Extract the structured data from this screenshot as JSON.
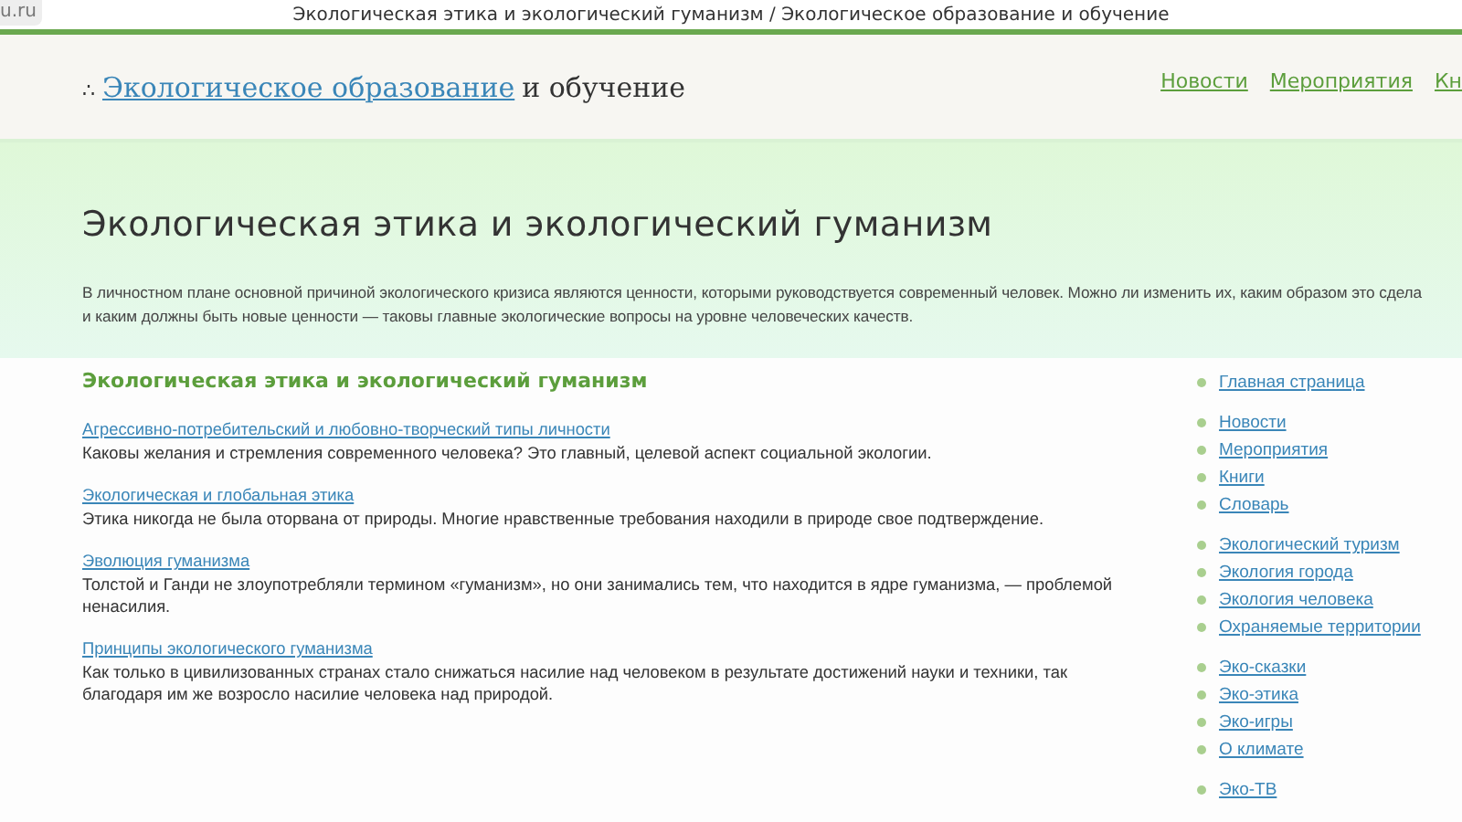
{
  "browser": {
    "tab_fragment": "u.ru",
    "title": "Экологическая этика и экологический гуманизм / Экологическое образование и обучение"
  },
  "header": {
    "logo_mark": "∴",
    "logo_link": "Экологическое образование",
    "logo_rest": "и обучение",
    "nav": [
      "Новости",
      "Мероприятия",
      "Кн"
    ]
  },
  "hero": {
    "title": "Экологическая этика и экологический гуманизм",
    "lines": [
      "В личностном плане основной причиной экологического кризиса являются ценности, которыми руководствуется современный человек. Можно ли изменить их, каким образом это сдела",
      "и каким должны быть новые ценности — таковы главные экологические вопросы на уровне человеческих качеств."
    ]
  },
  "main": {
    "heading": "Экологическая этика и экологический гуманизм",
    "articles": [
      {
        "link": "Агрессивно-потребительский и любовно-творческий типы личности",
        "text": "Каковы желания и стремления современного человека? Это главный, целевой аспект социальной экологии."
      },
      {
        "link": "Экологическая и глобальная этика",
        "text": "Этика никогда не была оторвана от природы. Многие нравственные требования находили в природе свое подтверждение."
      },
      {
        "link": "Эволюция гуманизма",
        "text": "Толстой и Ганди не злоупотребляли термином «гуманизм», но они занимались тем, что находится в ядре гуманизма, — проблемой ненасилия."
      },
      {
        "link": "Принципы экологического гуманизма",
        "text": "Как только в цивилизованных странах стало снижаться насилие над человеком в результате достижений науки и техники, так благодаря им же возросло насилие человека над природой."
      }
    ]
  },
  "sidebar": {
    "groups": [
      [
        "Главная страница"
      ],
      [
        "Новости",
        "Мероприятия",
        "Книги",
        "Словарь"
      ],
      [
        "Экологический туризм",
        "Экология города",
        "Экология человека",
        "Охраняемые территории"
      ],
      [
        "Эко-сказки",
        "Эко-этика",
        "Эко-игры",
        "О климате"
      ],
      [
        "Эко-ТВ"
      ]
    ]
  }
}
